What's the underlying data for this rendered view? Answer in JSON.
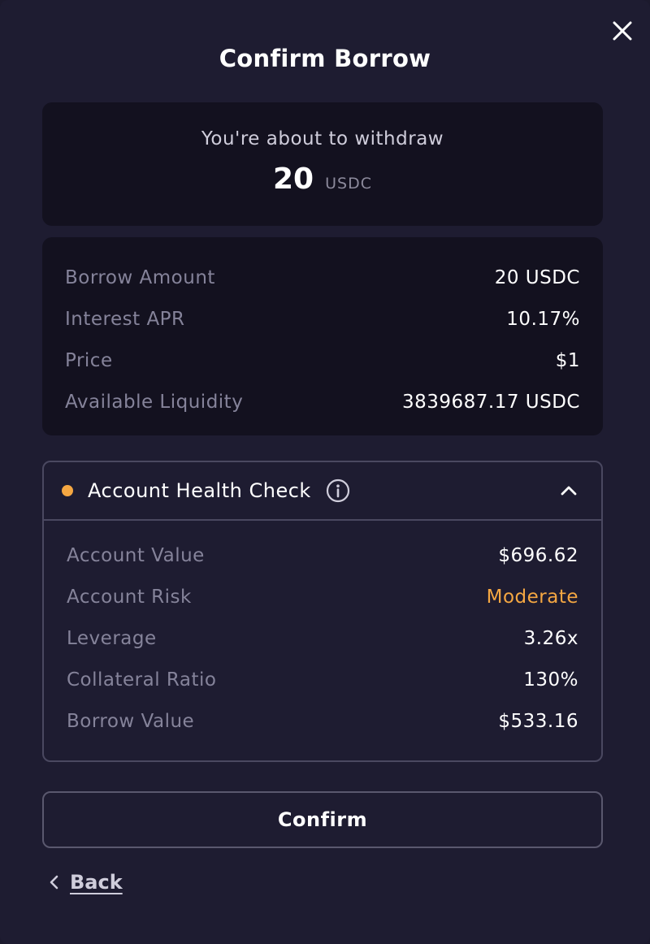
{
  "modal": {
    "title": "Confirm Borrow",
    "close_icon": "close-icon"
  },
  "summary": {
    "label": "You're about to withdraw",
    "amount": "20",
    "unit": "USDC"
  },
  "details": [
    {
      "label": "Borrow Amount",
      "value": "20 USDC"
    },
    {
      "label": "Interest APR",
      "value": "10.17%"
    },
    {
      "label": "Price",
      "value": "$1"
    },
    {
      "label": "Available Liquidity",
      "value": "3839687.17 USDC"
    }
  ],
  "health": {
    "title": "Account Health Check",
    "status_color": "#f5a742",
    "expanded": true,
    "rows": [
      {
        "label": "Account Value",
        "value": "$696.62"
      },
      {
        "label": "Account Risk",
        "value": "Moderate"
      },
      {
        "label": "Leverage",
        "value": "3.26x"
      },
      {
        "label": "Collateral Ratio",
        "value": "130%"
      },
      {
        "label": "Borrow Value",
        "value": "$533.16"
      }
    ]
  },
  "actions": {
    "confirm_label": "Confirm",
    "back_label": "Back"
  },
  "colors": {
    "background": "#1e1c31",
    "card": "#13111f",
    "accent_warning": "#f5a742",
    "muted_text": "#85839a"
  }
}
